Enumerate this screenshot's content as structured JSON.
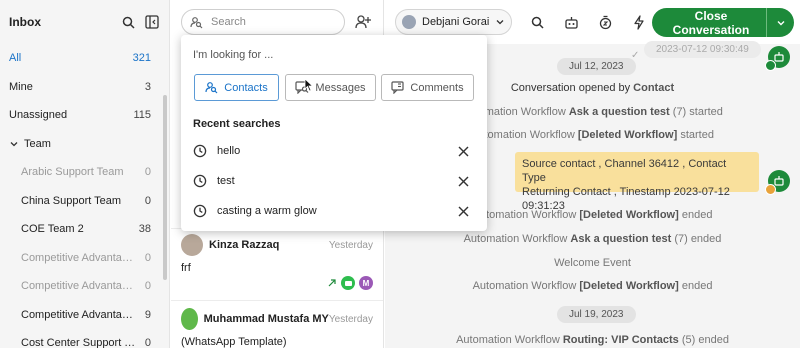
{
  "sidebar": {
    "title": "Inbox",
    "items": [
      {
        "label": "All",
        "count": "321"
      },
      {
        "label": "Mine",
        "count": "3"
      },
      {
        "label": "Unassigned",
        "count": "115"
      },
      {
        "label": "Team",
        "count": ""
      },
      {
        "label": "Arabic Support Team",
        "count": "0"
      },
      {
        "label": "China Support Team",
        "count": "0"
      },
      {
        "label": "COE Team 2",
        "count": "38"
      },
      {
        "label": "Competitive Advantage S...",
        "count": "0"
      },
      {
        "label": "Competitive Advantage S...",
        "count": "0"
      },
      {
        "label": "Competitive Advantage S...",
        "count": "9"
      },
      {
        "label": "Cost Center Support Team",
        "count": "0"
      }
    ]
  },
  "search": {
    "placeholder": "Search"
  },
  "dropdown": {
    "looking_for": "I'm looking for ...",
    "chips": [
      "Contacts",
      "Messages",
      "Comments"
    ],
    "recent_title": "Recent searches",
    "recent": [
      "hello",
      "test",
      "casting a warm glow"
    ]
  },
  "conversations": [
    {
      "name": "Kinza Razzaq",
      "time": "Yesterday",
      "message": "frf",
      "badge": "M"
    },
    {
      "name": "Muhammad Mustafa MY",
      "time": "Yesterday",
      "message": "(WhatsApp Template)"
    }
  ],
  "topbar": {
    "agent": "Debjani Gorai",
    "close_label": "Close Conversation"
  },
  "chat": {
    "top_timestamp": "2023-07-12 09:30:49",
    "date1": "Jul 12, 2023",
    "opened_prefix": "Conversation opened by",
    "opened_by": "Contact",
    "ev1_prefix": "Automation Workflow",
    "ev1_bold": "Ask a question test",
    "ev1_suffix": "(7) started",
    "ev2_prefix": "Automation Workflow",
    "ev2_bold": "[Deleted Workflow]",
    "ev2_suffix": "started",
    "note_line1": "Source contact , Channel 36412 , Contact Type",
    "note_line2": "Returning Contact , Tinestamp 2023-07-12 09:31:23",
    "ev3_prefix": "Automation Workflow",
    "ev3_bold": "[Deleted Workflow]",
    "ev3_suffix": "ended",
    "ev4_prefix": "Automation Workflow",
    "ev4_bold": "Ask a question test",
    "ev4_suffix": "(7) ended",
    "welcome": "Welcome Event",
    "ev5_prefix": "Automation Workflow",
    "ev5_bold": "[Deleted Workflow]",
    "ev5_suffix": "ended",
    "date2": "Jul 19, 2023",
    "ev6_prefix": "Automation Workflow",
    "ev6_bold": "Routing: VIP Contacts",
    "ev6_suffix": "(5) ended"
  },
  "colors": {
    "accent": "#1a73c8",
    "close_button": "#1d8a3a",
    "note_bg": "#f9e09c"
  },
  "icons": [
    "search-icon",
    "collapse-panel-icon",
    "chevron-down-icon",
    "add-contact-icon",
    "clock-icon",
    "close-icon",
    "robot-icon",
    "timer-icon",
    "lightning-icon",
    "mouse-cursor-icon"
  ]
}
